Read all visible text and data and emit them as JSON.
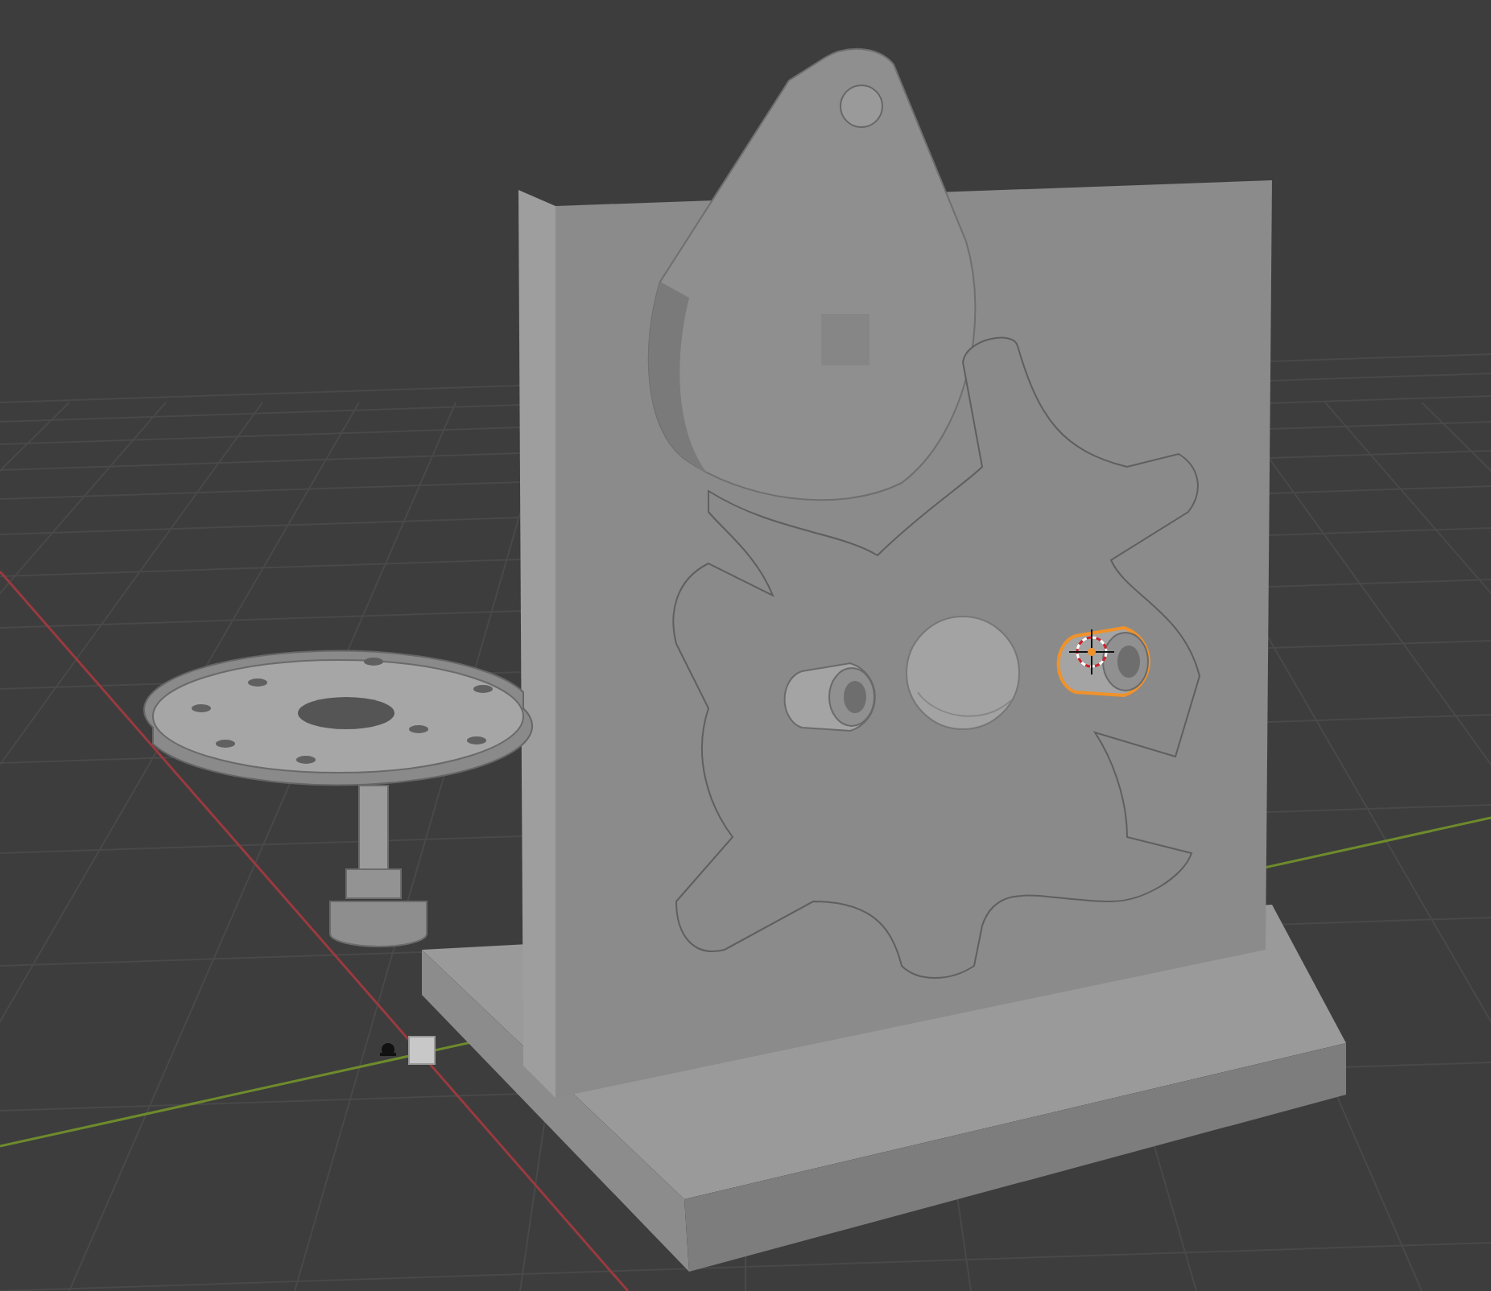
{
  "viewport": {
    "objects": [
      {
        "kind": "base-plate",
        "selected": false
      },
      {
        "kind": "back-panel",
        "selected": false
      },
      {
        "kind": "drive-wheel",
        "selected": false
      },
      {
        "kind": "star-wheel",
        "selected": false
      },
      {
        "kind": "sphere",
        "selected": false
      },
      {
        "kind": "pin",
        "selected": false
      },
      {
        "kind": "pin",
        "selected": true
      },
      {
        "kind": "disc",
        "selected": false
      },
      {
        "kind": "shaft",
        "selected": false
      },
      {
        "kind": "cube",
        "selected": false
      }
    ]
  }
}
